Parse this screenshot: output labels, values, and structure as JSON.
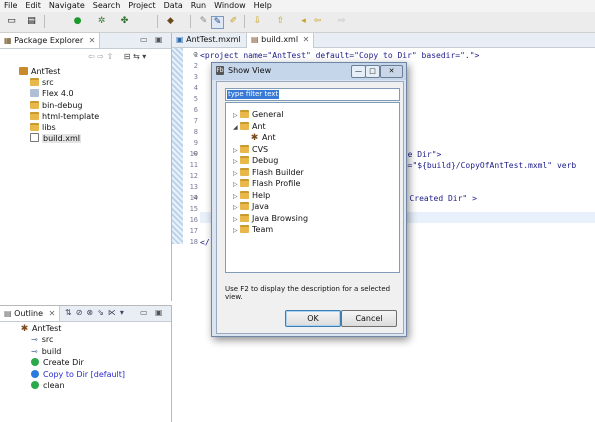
{
  "menu": [
    "File",
    "Edit",
    "Navigate",
    "Search",
    "Project",
    "Data",
    "Run",
    "Window",
    "Help"
  ],
  "package_explorer": {
    "tab_label": "Package Explorer",
    "tree": [
      {
        "label": "AntTest",
        "icon": "project-icon",
        "indent": 0
      },
      {
        "label": "src",
        "icon": "source-folder-icon",
        "indent": 1
      },
      {
        "label": "Flex 4.0",
        "icon": "library-icon",
        "indent": 1
      },
      {
        "label": "bin-debug",
        "icon": "folder-icon",
        "indent": 1
      },
      {
        "label": "html-template",
        "icon": "folder-icon",
        "indent": 1
      },
      {
        "label": "libs",
        "icon": "folder-icon",
        "indent": 1
      },
      {
        "label": "build.xml",
        "icon": "xml-file-icon",
        "indent": 1,
        "selected": true
      }
    ]
  },
  "outline": {
    "tab_label": "Outline",
    "items": [
      {
        "label": "AntTest",
        "icon": "ant-project-icon",
        "indent": 0
      },
      {
        "label": "src",
        "icon": "property-icon",
        "indent": 1
      },
      {
        "label": "build",
        "icon": "property-icon",
        "indent": 1
      },
      {
        "label": "Create Dir",
        "icon": "target-icon",
        "indent": 1
      },
      {
        "label": "Copy to Dir [default]",
        "icon": "default-target-icon",
        "indent": 1,
        "highlight": true
      },
      {
        "label": "clean",
        "icon": "target-icon",
        "indent": 1
      }
    ]
  },
  "editor": {
    "tabs": [
      {
        "label": "AntTest.mxml",
        "active": false
      },
      {
        "label": "build.xml",
        "active": true
      }
    ],
    "line_numbers": [
      "1",
      "2",
      "3",
      "4",
      "5",
      "6",
      "7",
      "8",
      "9",
      "10",
      "11",
      "12",
      "13",
      "14",
      "15",
      "16",
      "17",
      "18"
    ],
    "code_lines": [
      {
        "line": 1,
        "text": "<project name=\"AntTest\" default=\"Copy to Dir\" basedir=\".\">"
      },
      {
        "line": 10,
        "text": "ate Dir\">"
      },
      {
        "line": 11,
        "text": "le=\"${build}/CopyOfAntTest.mxml\" verb"
      },
      {
        "line": 14,
        "text": "es Created Dir\" >"
      },
      {
        "line": 18,
        "text": "</"
      }
    ]
  },
  "dialog": {
    "title": "Show View",
    "filter_placeholder": "type filter text",
    "items": [
      {
        "label": "General",
        "indent": 0,
        "expanded": false
      },
      {
        "label": "Ant",
        "indent": 0,
        "expanded": true
      },
      {
        "label": "Ant",
        "indent": 1,
        "leaf": true
      },
      {
        "label": "CVS",
        "indent": 0,
        "expanded": false
      },
      {
        "label": "Debug",
        "indent": 0,
        "expanded": false
      },
      {
        "label": "Flash Builder",
        "indent": 0,
        "expanded": false
      },
      {
        "label": "Flash Profile",
        "indent": 0,
        "expanded": false
      },
      {
        "label": "Help",
        "indent": 0,
        "expanded": false
      },
      {
        "label": "Java",
        "indent": 0,
        "expanded": false
      },
      {
        "label": "Java Browsing",
        "indent": 0,
        "expanded": false
      },
      {
        "label": "Team",
        "indent": 0,
        "expanded": false
      }
    ],
    "hint": "Use F2 to display the description for a selected view.",
    "ok_label": "OK",
    "cancel_label": "Cancel",
    "minimize_glyph": "—",
    "maximize_glyph": "□",
    "close_glyph": "✕"
  },
  "colors": {
    "selection": "#3779d6",
    "dialog_bg": "#dbe5f1",
    "folder": "#e8b84a",
    "code_text": "#20208a",
    "link_blue": "#2a2ad0"
  }
}
